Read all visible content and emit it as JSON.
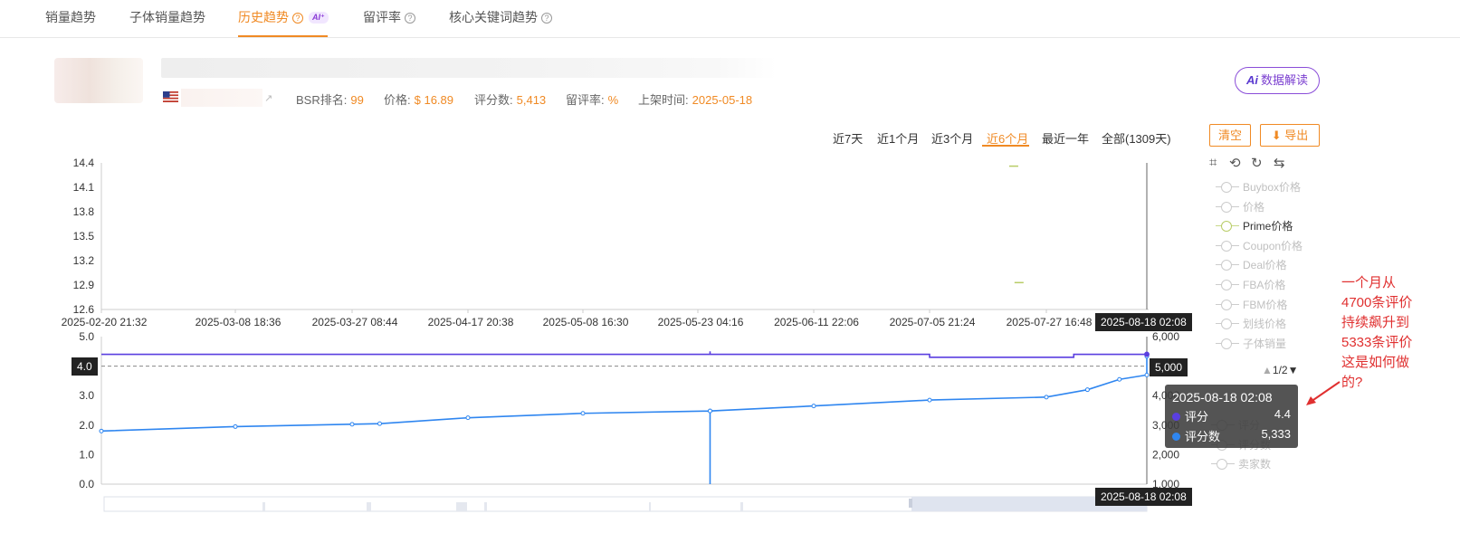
{
  "tabs": [
    {
      "label": "销量趋势"
    },
    {
      "label": "子体销量趋势"
    },
    {
      "label": "历史趋势",
      "badge": "AI⁺"
    },
    {
      "label": "留评率"
    },
    {
      "label": "核心关键词趋势"
    }
  ],
  "product": {
    "stats": [
      {
        "label": "BSR排名:",
        "value": "99"
      },
      {
        "label": "价格:",
        "value": "$ 16.89"
      },
      {
        "label": "评分数:",
        "value": "5,413"
      },
      {
        "label": "留评率:",
        "value": "%"
      },
      {
        "label": "上架时间:",
        "value": "2025-05-18"
      }
    ]
  },
  "ai_button": "数据解读",
  "ai_button_icon": "Ai",
  "ranges": [
    "近7天",
    "近1个月",
    "近3个月",
    "近6个月",
    "最近一年",
    "全部(1309天)"
  ],
  "active_range": "近6个月",
  "buttons": {
    "clear": "清空",
    "export": "导出"
  },
  "legend": {
    "items": [
      {
        "label": "Buybox价格",
        "on": false
      },
      {
        "label": "价格",
        "on": false
      },
      {
        "label": "Prime价格",
        "on": true
      },
      {
        "label": "Coupon价格",
        "on": false
      },
      {
        "label": "Deal价格",
        "on": false
      },
      {
        "label": "FBA价格",
        "on": false
      },
      {
        "label": "FBM价格",
        "on": false
      },
      {
        "label": "划线价格",
        "on": false
      },
      {
        "label": "子体销量",
        "on": false
      }
    ],
    "page": "1/2",
    "lower_items": [
      "评分",
      "评分数",
      "卖家数"
    ]
  },
  "crosshair": {
    "date": "2025-08-18 02:08",
    "left_value": "4.0",
    "right_value": "5,000"
  },
  "tooltip": {
    "date": "2025-08-18 02:08",
    "rows": [
      {
        "name": "评分",
        "value": "4.4",
        "color": "#5a3fe0"
      },
      {
        "name": "评分数",
        "value": "5,333",
        "color": "#2f86f0"
      }
    ]
  },
  "annotation": "一个月从4700条评价持续飙升到5333条评价这是如何做的?",
  "chart_data": [
    {
      "type": "line",
      "title": "",
      "x_ticks": [
        "2025-02-20 21:32",
        "2025-03-08 18:36",
        "2025-03-27 08:44",
        "2025-04-17 20:38",
        "2025-05-08 16:30",
        "2025-05-23 04:16",
        "2025-06-11 22:06",
        "2025-07-05 21:24",
        "2025-07-27 16:48"
      ],
      "y_ticks": [
        "14.4",
        "14.1",
        "13.8",
        "13.5",
        "13.2",
        "12.9",
        "12.6"
      ],
      "ylim": [
        12.6,
        14.4
      ],
      "series": [
        {
          "name": "Prime价格",
          "color": "#b8cc66",
          "points": [
            [
              "2025-07-20",
              14.36
            ],
            [
              "2025-07-21",
              12.93
            ]
          ]
        }
      ]
    },
    {
      "type": "line",
      "title": "",
      "y_left_ticks": [
        "5.0",
        "4.0",
        "3.0",
        "2.0",
        "1.0",
        "0.0"
      ],
      "y_right_ticks": [
        "6,000",
        "5,000",
        "4,000",
        "3,000",
        "2,000",
        "1,000"
      ],
      "ylim_left": [
        0,
        5
      ],
      "ylim_right": [
        1000,
        6000
      ],
      "series": [
        {
          "name": "评分",
          "axis": "left",
          "color": "#5a3fe0",
          "points": [
            [
              "2025-02-20",
              4.4
            ],
            [
              "2025-05-25",
              4.4
            ],
            [
              "2025-05-25",
              4.5
            ],
            [
              "2025-05-25",
              4.4
            ],
            [
              "2025-07-05",
              4.4
            ],
            [
              "2025-07-05",
              4.3
            ],
            [
              "2025-08-02",
              4.3
            ],
            [
              "2025-08-02",
              4.4
            ],
            [
              "2025-08-18",
              4.4
            ]
          ]
        },
        {
          "name": "评分数",
          "axis": "right",
          "color": "#2f86f0",
          "points": [
            [
              "2025-02-20",
              2800
            ],
            [
              "2025-03-08",
              2950
            ],
            [
              "2025-03-27",
              3030
            ],
            [
              "2025-04-01",
              3050
            ],
            [
              "2025-04-17",
              3250
            ],
            [
              "2025-05-08",
              3400
            ],
            [
              "2025-05-25",
              3480
            ],
            [
              "2025-05-25",
              1000
            ],
            [
              "2025-05-25",
              3480
            ],
            [
              "2025-06-11",
              3650
            ],
            [
              "2025-07-05",
              3850
            ],
            [
              "2025-07-27",
              3950
            ],
            [
              "2025-08-05",
              4200
            ],
            [
              "2025-08-12",
              4550
            ],
            [
              "2025-08-18",
              4700
            ],
            [
              "2025-08-18",
              5333
            ]
          ]
        }
      ]
    }
  ]
}
